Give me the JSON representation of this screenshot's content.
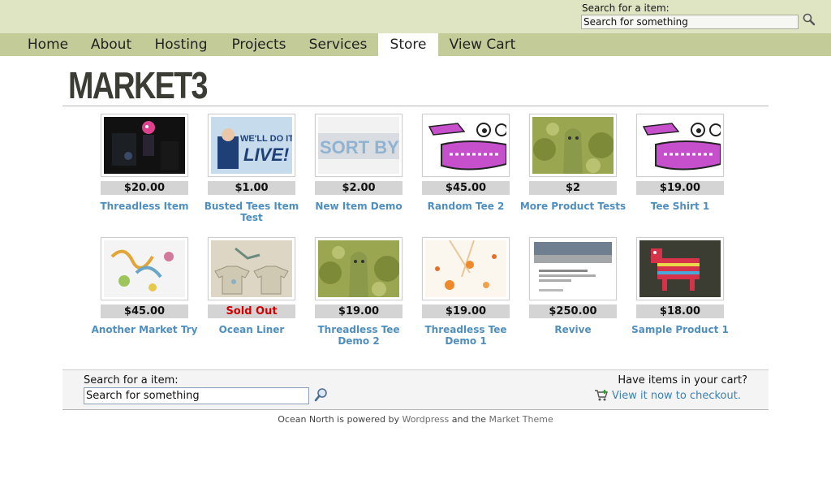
{
  "header": {
    "search_label": "Search for a item:",
    "search_value": "Search for something"
  },
  "nav": {
    "items": [
      {
        "label": "Home"
      },
      {
        "label": "About"
      },
      {
        "label": "Hosting"
      },
      {
        "label": "Projects"
      },
      {
        "label": "Services"
      },
      {
        "label": "Store",
        "active": true
      },
      {
        "label": "View Cart"
      }
    ]
  },
  "logo": {
    "text": "MARKET3"
  },
  "products": [
    {
      "price": "$20.00",
      "title": "Threadless Item",
      "image": "dark-pink-creature"
    },
    {
      "price": "$1.00",
      "title": "Busted Tees Item Test",
      "image": "well-do-it-live"
    },
    {
      "price": "$2.00",
      "title": "New Item Demo",
      "image": "sort-by-pr"
    },
    {
      "price": "$45.00",
      "title": "Random Tee 2",
      "image": "purple-dinosaur"
    },
    {
      "price": "$2",
      "title": "More Product Tests",
      "image": "green-forest-monster"
    },
    {
      "price": "$19.00",
      "title": "Tee Shirt 1",
      "image": "purple-dinosaur"
    },
    {
      "price": "$45.00",
      "title": "Another Market Try",
      "image": "colorful-doodles"
    },
    {
      "price": "Sold Out",
      "title": "Ocean Liner",
      "image": "ocean-liner-tees",
      "sold_out": true
    },
    {
      "price": "$19.00",
      "title": "Threadless Tee Demo 2",
      "image": "green-forest-monster"
    },
    {
      "price": "$19.00",
      "title": "Threadless Tee Demo 1",
      "image": "orange-flowers"
    },
    {
      "price": "$250.00",
      "title": "Revive",
      "image": "website-screenshot"
    },
    {
      "price": "$18.00",
      "title": "Sample Product 1",
      "image": "red-pinata-donkey"
    }
  ],
  "footer_search": {
    "label": "Search for a item:",
    "value": "Search for something"
  },
  "cart": {
    "label": "Have items in your cart?",
    "link": "View it now to checkout."
  },
  "footer": {
    "prefix": "Ocean North is powered by",
    "wordpress": "Wordpress",
    "middle": "and the",
    "theme": "Market Theme"
  },
  "colors": {
    "top_band": "#dfe5c3",
    "nav_bar": "#c3cc98",
    "link_blue": "#4f8fbf",
    "sold_out_red": "#d10000"
  }
}
